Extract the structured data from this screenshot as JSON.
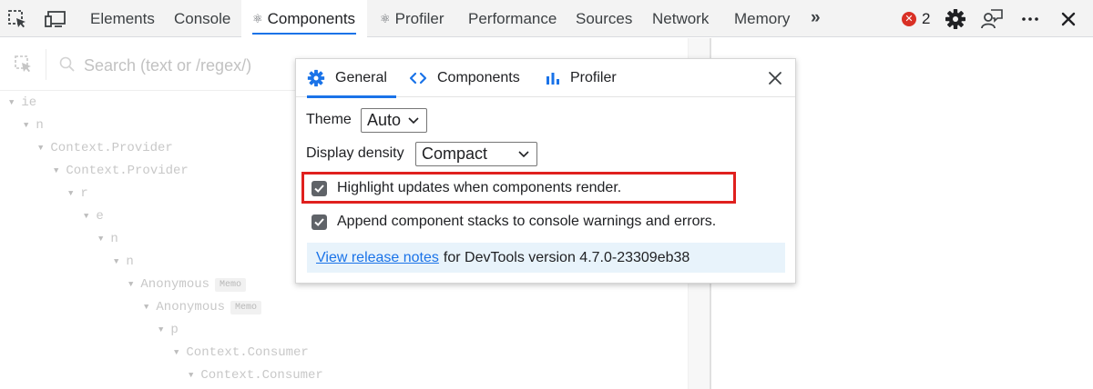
{
  "toolbar": {
    "tabs": [
      {
        "label": "Elements"
      },
      {
        "label": "Console"
      },
      {
        "label": "Components",
        "glyph": "⚛"
      },
      {
        "label": "Profiler",
        "glyph": "⚛"
      },
      {
        "label": "Performance"
      },
      {
        "label": "Sources"
      },
      {
        "label": "Network"
      },
      {
        "label": "Memory"
      }
    ],
    "more_tabs": "»",
    "error_count": "2",
    "error_glyph": "✕"
  },
  "search": {
    "placeholder": "Search (text or /regex/)"
  },
  "tree": [
    {
      "label": "ie"
    },
    {
      "label": "n"
    },
    {
      "label": "Context.Provider"
    },
    {
      "label": "Context.Provider"
    },
    {
      "label": "r"
    },
    {
      "label": "e"
    },
    {
      "label": "n"
    },
    {
      "label": "n"
    },
    {
      "label": "Anonymous",
      "badge": "Memo"
    },
    {
      "label": "Anonymous",
      "badge": "Memo"
    },
    {
      "label": "p"
    },
    {
      "label": "Context.Consumer"
    },
    {
      "label": "Context.Consumer"
    }
  ],
  "settings": {
    "tabs": {
      "general": "General",
      "components": "Components",
      "profiler": "Profiler"
    },
    "theme_label": "Theme",
    "theme_value": "Auto",
    "density_label": "Display density",
    "density_value": "Compact",
    "highlight_updates": "Highlight updates when components render.",
    "append_stacks": "Append component stacks to console warnings and errors.",
    "release_link": "View release notes",
    "release_suffix": "for DevTools version 4.7.0-23309eb38"
  },
  "colors": {
    "accent": "#1a73e8",
    "highlight_border": "#e0201e",
    "notes_background": "#e8f3fb"
  }
}
